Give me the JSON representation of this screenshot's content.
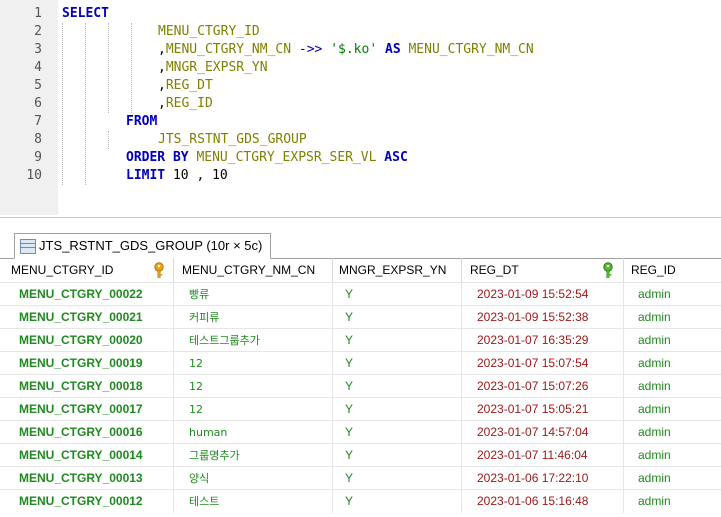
{
  "editor": {
    "line_numbers": [
      "1",
      "2",
      "3",
      "4",
      "5",
      "6",
      "7",
      "8",
      "9",
      "10"
    ],
    "lines": [
      [
        {
          "t": "SELECT",
          "c": "kw"
        }
      ],
      [
        {
          "t": "MENU_CTGRY_ID",
          "c": "id"
        }
      ],
      [
        {
          "t": ",",
          "c": "punc"
        },
        {
          "t": "MENU_CTGRY_NM_CN",
          "c": "id"
        },
        {
          "t": " ->> ",
          "c": "op"
        },
        {
          "t": "'$.ko'",
          "c": "str"
        },
        {
          "t": " AS ",
          "c": "kw"
        },
        {
          "t": "MENU_CTGRY_NM_CN",
          "c": "id"
        }
      ],
      [
        {
          "t": ",",
          "c": "punc"
        },
        {
          "t": "MNGR_EXPSR_YN",
          "c": "id"
        }
      ],
      [
        {
          "t": ",",
          "c": "punc"
        },
        {
          "t": "REG_DT",
          "c": "id"
        }
      ],
      [
        {
          "t": ",",
          "c": "punc"
        },
        {
          "t": "REG_ID",
          "c": "id"
        }
      ],
      [
        {
          "t": "FROM",
          "c": "kw"
        }
      ],
      [
        {
          "t": "JTS_RSTNT_GDS_GROUP",
          "c": "id"
        }
      ],
      [
        {
          "t": "ORDER BY",
          "c": "kw"
        },
        {
          "t": " MENU_CTGRY_EXPSR_SER_VL",
          "c": "id"
        },
        {
          "t": " ASC",
          "c": "kw"
        }
      ],
      [
        {
          "t": "LIMIT",
          "c": "kw"
        },
        {
          "t": " 10",
          "c": "num"
        },
        {
          "t": " , ",
          "c": "punc"
        },
        {
          "t": "10",
          "c": "num"
        }
      ]
    ]
  },
  "result_tab": {
    "label": "JTS_RSTNT_GDS_GROUP (10r × 5c)",
    "icon": "table-grid-icon"
  },
  "table": {
    "columns": [
      {
        "label": "MENU_CTGRY_ID",
        "key_icon": "primary-key-icon",
        "key_color": "#e8a317"
      },
      {
        "label": "MENU_CTGRY_NM_CN"
      },
      {
        "label": "MNGR_EXPSR_YN"
      },
      {
        "label": "REG_DT",
        "key_icon": "index-key-icon",
        "key_color": "#58b832"
      },
      {
        "label": "REG_ID"
      }
    ],
    "rows": [
      [
        "MENU_CTGRY_00022",
        "빵류",
        "Y",
        "2023-01-09 15:52:54",
        "admin"
      ],
      [
        "MENU_CTGRY_00021",
        "커피류",
        "Y",
        "2023-01-09 15:52:38",
        "admin"
      ],
      [
        "MENU_CTGRY_00020",
        "테스트그룹추가",
        "Y",
        "2023-01-07 16:35:29",
        "admin"
      ],
      [
        "MENU_CTGRY_00019",
        "12",
        "Y",
        "2023-01-07 15:07:54",
        "admin"
      ],
      [
        "MENU_CTGRY_00018",
        "12",
        "Y",
        "2023-01-07 15:07:26",
        "admin"
      ],
      [
        "MENU_CTGRY_00017",
        "12",
        "Y",
        "2023-01-07 15:05:21",
        "admin"
      ],
      [
        "MENU_CTGRY_00016",
        "human",
        "Y",
        "2023-01-07 14:57:04",
        "admin"
      ],
      [
        "MENU_CTGRY_00014",
        "그룹명추가",
        "Y",
        "2023-01-07 11:46:04",
        "admin"
      ],
      [
        "MENU_CTGRY_00013",
        "양식",
        "Y",
        "2023-01-06 17:22:10",
        "admin"
      ],
      [
        "MENU_CTGRY_00012",
        "테스트",
        "Y",
        "2023-01-06 15:16:48",
        "admin"
      ]
    ]
  }
}
